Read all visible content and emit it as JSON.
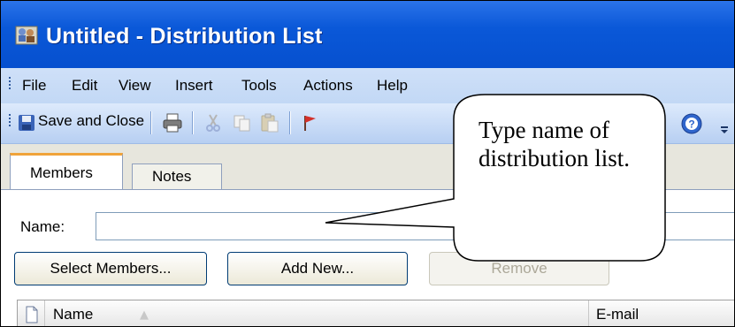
{
  "window": {
    "title": "Untitled - Distribution List"
  },
  "menu": {
    "items": [
      {
        "label": "File"
      },
      {
        "label": "Edit"
      },
      {
        "label": "View"
      },
      {
        "label": "Insert"
      },
      {
        "label": "Tools"
      },
      {
        "label": "Actions"
      },
      {
        "label": "Help"
      }
    ]
  },
  "toolbar": {
    "save_label": "Save and Close",
    "icons": [
      "save-icon",
      "print-icon",
      "cut-icon",
      "copy-icon",
      "paste-icon",
      "flag-icon",
      "help-icon"
    ]
  },
  "tabs": [
    {
      "label": "Members",
      "active": true
    },
    {
      "label": "Notes",
      "active": false
    }
  ],
  "form": {
    "name_label": "Name:",
    "name_value": ""
  },
  "buttons": {
    "select_members": "Select Members...",
    "add_new": "Add New...",
    "remove": "Remove"
  },
  "list": {
    "columns": [
      "Name",
      "E-mail"
    ]
  },
  "callout": {
    "text": "Type name of distribution list."
  },
  "colors": {
    "title_bar": "#0a58d8",
    "active_tab_accent": "#f0a33a"
  }
}
